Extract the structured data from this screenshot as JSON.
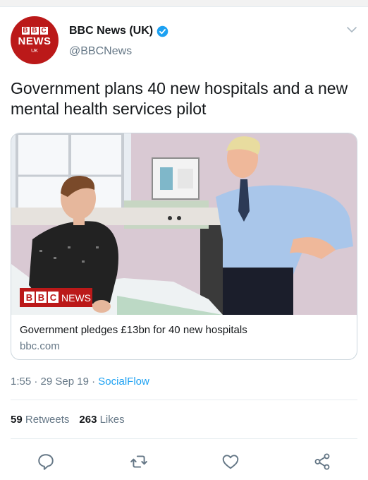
{
  "account": {
    "avatar_blocks": [
      "B",
      "B",
      "C"
    ],
    "avatar_news": "NEWS",
    "avatar_region": "UK",
    "display_name": "BBC News (UK)",
    "handle": "@BBCNews",
    "verified": true
  },
  "tweet": {
    "text": "Government plans 40 new hospitals and a new mental health services pilot"
  },
  "card": {
    "image_logo_blocks": [
      "B",
      "B",
      "C"
    ],
    "image_logo_word": "NEWS",
    "title": "Government pledges £13bn for 40 new hospitals",
    "domain": "bbc.com"
  },
  "meta": {
    "time": "1:55",
    "date": "29 Sep 19",
    "separator": " · ",
    "source": "SocialFlow"
  },
  "stats": {
    "retweets_count": "59",
    "retweets_label": "Retweets",
    "likes_count": "263",
    "likes_label": "Likes"
  },
  "actions": [
    "reply-icon",
    "retweet-icon",
    "like-icon",
    "share-icon"
  ],
  "colors": {
    "bbc_red": "#bb1919",
    "link_blue": "#1da1f2",
    "muted": "#657786"
  }
}
